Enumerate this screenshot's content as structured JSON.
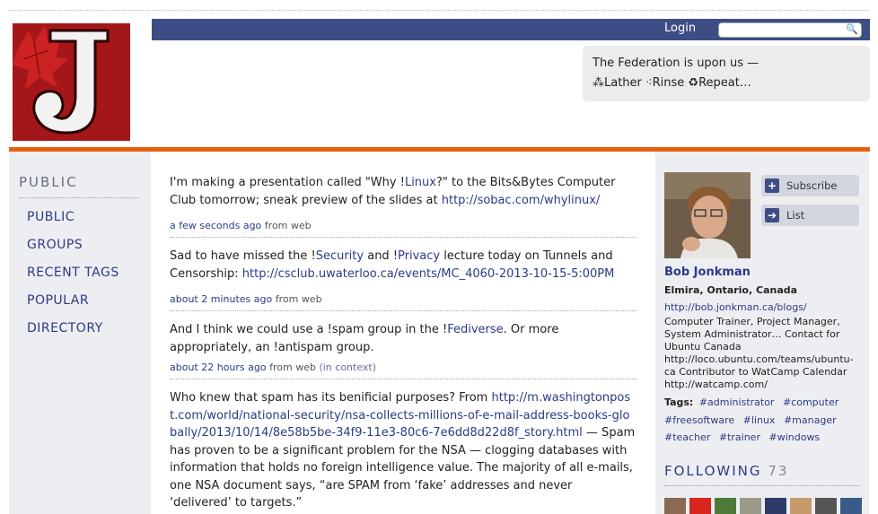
{
  "header": {
    "login_label": "Login",
    "search_placeholder": "",
    "notice_line1": "The Federation is upon us —",
    "notice_line2": "⁂Lather ⁖Rinse ♻Repeat…"
  },
  "nav": {
    "heading": "PUBLIC",
    "items": [
      {
        "label": "PUBLIC"
      },
      {
        "label": "GROUPS"
      },
      {
        "label": "RECENT TAGS"
      },
      {
        "label": "POPULAR"
      },
      {
        "label": "DIRECTORY"
      }
    ]
  },
  "notices": [
    {
      "parts": [
        "I'm making a presentation called \"Why !",
        "Linux",
        "?\" to the Bits&Bytes Computer Club tomorrow; sneak preview of the slides at ",
        "http://sobac.com/whylinux/"
      ],
      "time": "a few seconds ago",
      "source": "from web"
    },
    {
      "parts": [
        "Sad to have missed the !",
        "Security",
        " and !",
        "Privacy",
        " lecture today on Tunnels and Censorship: ",
        "http://csclub.uwaterloo.ca/events/MC_4060-2013-10-15-5:00PM"
      ],
      "time": "about 2 minutes ago",
      "source": "from web"
    },
    {
      "parts": [
        "And I think we could use a !spam group in the !",
        "Fediverse",
        ". Or more appropriately, an !antispam group."
      ],
      "time": "about 22 hours ago",
      "source": "from web",
      "context": "(in context)"
    },
    {
      "parts": [
        "Who knew that spam has its benificial purposes? From ",
        "http://m.washingtonpost.com/world/national-security/nsa-collects-millions-of-e-mail-address-books-globally/2013/10/14/8e58b5be-34f9-11e3-80c6-7e6dd8d22d8f_story.html",
        " — Spam has proven to be a significant problem for the NSA — clogging databases with information that holds no foreign intelligence value. The majority of all e-mails, one NSA document says, “are SPAM from ‘fake’ addresses and never ‘delivered’ to targets.”"
      ]
    }
  ],
  "profile": {
    "subscribe_label": "Subscribe",
    "list_label": "List",
    "name": "Bob Jonkman",
    "location": "Elmira, Ontario, Canada",
    "url": "http://bob.jonkman.ca/blogs/",
    "bio": "Computer Trainer, Project Manager, System Administrator…  Contact for Ubuntu Canada http://loco.ubuntu.com/teams/ubuntu-ca Contributor to WatCamp Calendar http://watcamp.com/",
    "tags_label": "Tags:",
    "tags": [
      "#administrator",
      "#computer",
      "#freesoftware",
      "#linux",
      "#manager",
      "#teacher",
      "#trainer",
      "#windows"
    ],
    "following_label": "FOLLOWING",
    "following_count": "73"
  },
  "colors": {
    "accent_orange": "#e8600e",
    "nav_bar": "#3d4d86",
    "link": "#2c3a86",
    "logo_bg": "#a3171a"
  }
}
